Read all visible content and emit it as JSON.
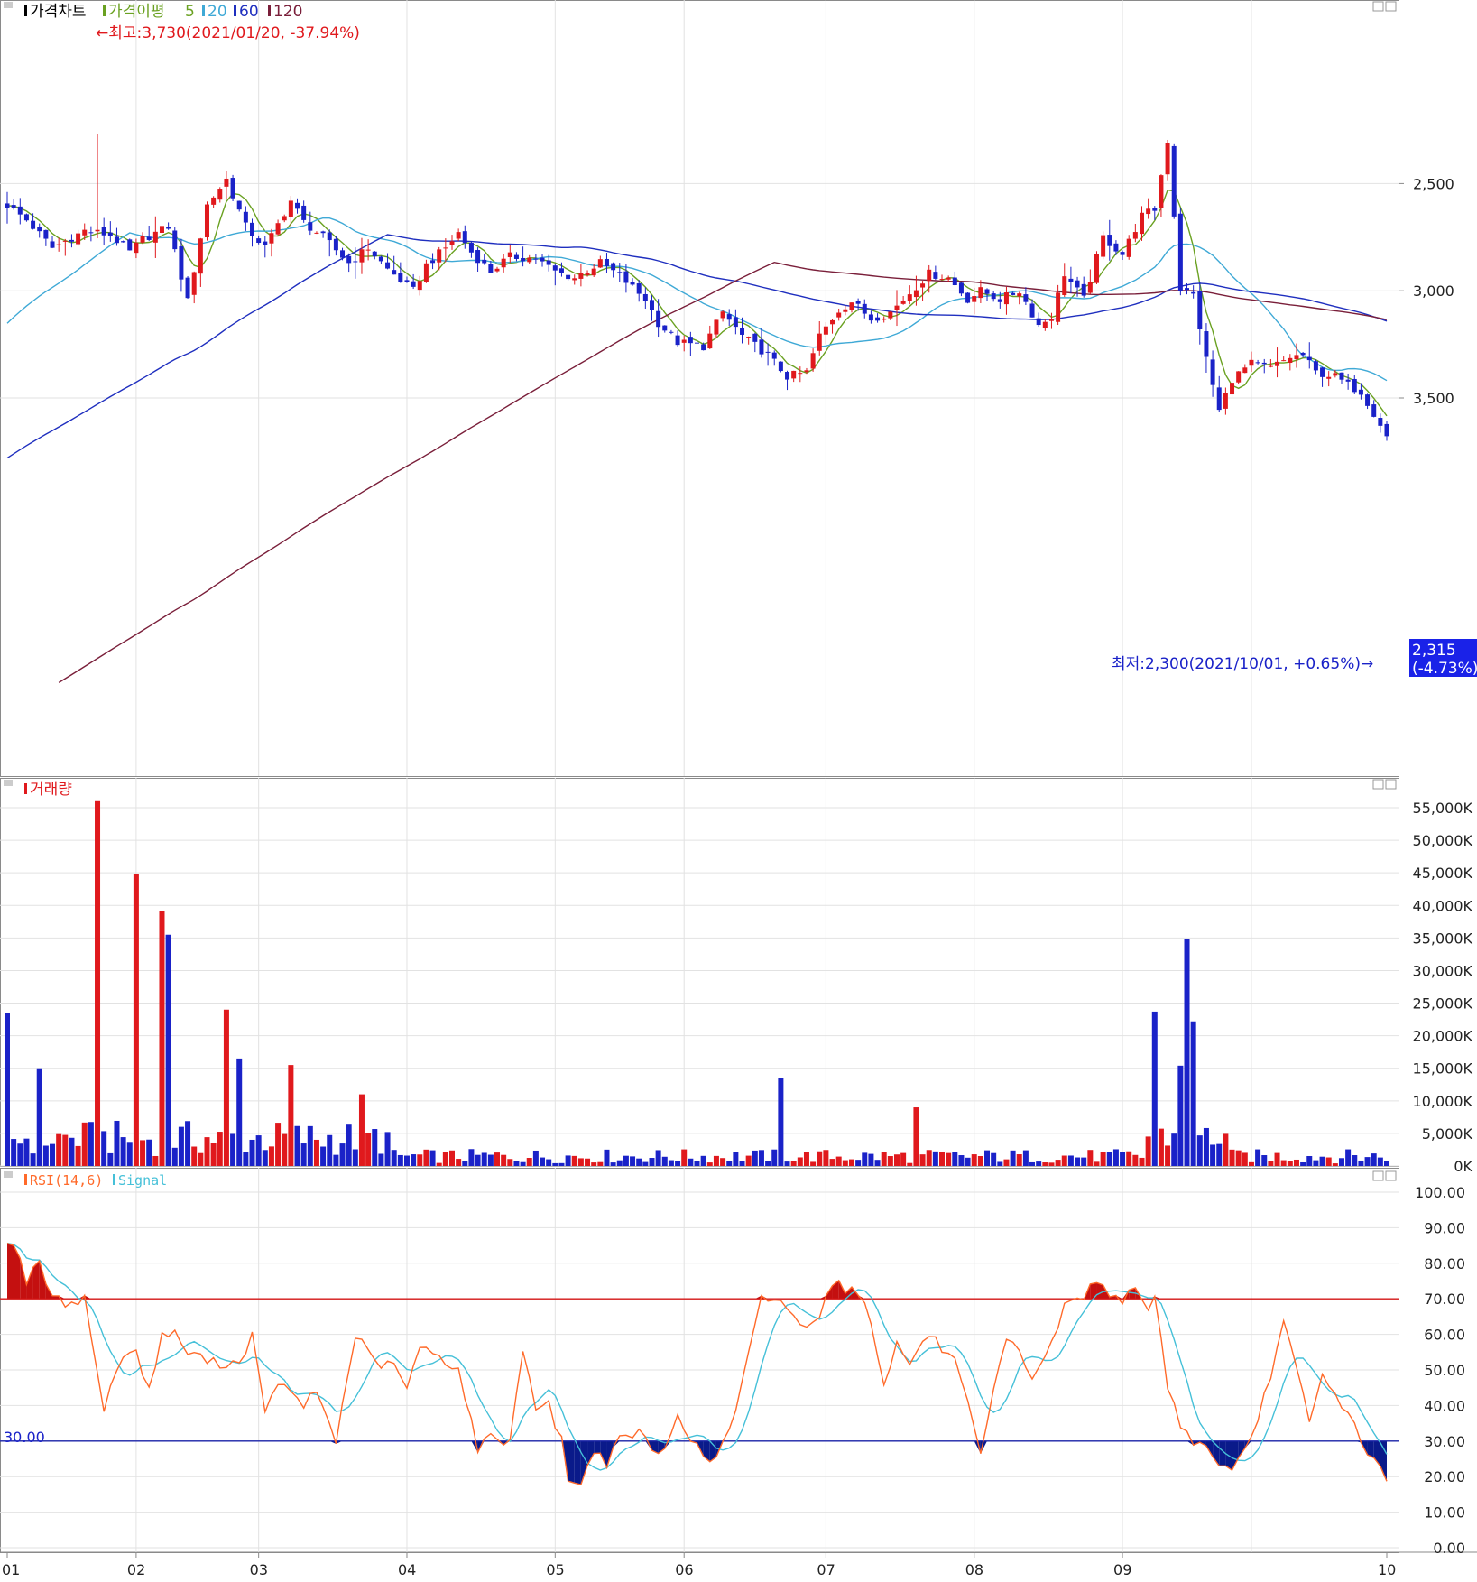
{
  "panels": {
    "price": {
      "legend": {
        "name": "가격차트",
        "ma_prefix": "가격이평",
        "ma": [
          {
            "label": "5",
            "color": "#6aa121"
          },
          {
            "label": "20",
            "color": "#3fa9d6"
          },
          {
            "label": "60",
            "color": "#1f2fbf"
          },
          {
            "label": "120",
            "color": "#7a1f3a"
          }
        ]
      },
      "high_annotation": "←최고:3,730(2021/01/20, -37.94%)",
      "low_annotation": "최저:2,300(2021/10/01, +0.65%)→",
      "current_price": "2,315",
      "current_change": "(-4.73%)",
      "y_ticks": [
        "3,500",
        "3,000",
        "2,500"
      ]
    },
    "volume": {
      "legend": {
        "name": "거래량"
      },
      "y_ticks": [
        "55,000K",
        "50,000K",
        "45,000K",
        "40,000K",
        "35,000K",
        "30,000K",
        "25,000K",
        "20,000K",
        "15,000K",
        "10,000K",
        "5,000K",
        "0K"
      ]
    },
    "rsi": {
      "legend": {
        "rsi": "RSI(14,6)",
        "signal": "Signal"
      },
      "level_label": "30.00",
      "y_ticks": [
        "100.00",
        "90.00",
        "80.00",
        "70.00",
        "60.00",
        "50.00",
        "40.00",
        "30.00",
        "20.00",
        "10.00",
        "0.00"
      ]
    }
  },
  "x_labels": [
    "01",
    "02",
    "03",
    "04",
    "05",
    "06",
    "07",
    "08",
    "09",
    "10"
  ],
  "colors": {
    "up": "#e0191d",
    "down": "#1a22c8",
    "rsi": "#ff6a2a",
    "signal": "#45c0d8",
    "overbought_fill": "#c41010",
    "oversold_fill": "#0a1a8a"
  },
  "chart_data": [
    {
      "type": "candlestick",
      "title": "가격차트",
      "ylim": [
        2050,
        3800
      ],
      "y_ticks": [
        2500,
        3000,
        3500
      ],
      "high": {
        "value": 3730,
        "date": "2021/01/20",
        "pct": -37.94
      },
      "low": {
        "value": 2300,
        "date": "2021/10/01",
        "pct": 0.65
      },
      "last": {
        "value": 2315,
        "pct": -4.73
      },
      "close_anchors": [
        [
          0,
          3400
        ],
        [
          3,
          3330
        ],
        [
          7,
          3200
        ],
        [
          12,
          3280
        ],
        [
          16,
          3260
        ],
        [
          19,
          3180
        ],
        [
          21,
          3240
        ],
        [
          25,
          3300
        ],
        [
          28,
          2950
        ],
        [
          31,
          3400
        ],
        [
          34,
          3520
        ],
        [
          37,
          3300
        ],
        [
          40,
          3200
        ],
        [
          44,
          3420
        ],
        [
          46,
          3320
        ],
        [
          49,
          3250
        ],
        [
          53,
          3130
        ],
        [
          56,
          3200
        ],
        [
          59,
          3100
        ],
        [
          63,
          3000
        ],
        [
          65,
          3120
        ],
        [
          68,
          3200
        ],
        [
          70,
          3270
        ],
        [
          72,
          3180
        ],
        [
          75,
          3090
        ],
        [
          78,
          3160
        ],
        [
          82,
          3150
        ],
        [
          85,
          3090
        ],
        [
          88,
          3060
        ],
        [
          92,
          3130
        ],
        [
          95,
          3070
        ],
        [
          99,
          2960
        ],
        [
          101,
          2850
        ],
        [
          104,
          2760
        ],
        [
          108,
          2740
        ],
        [
          111,
          2900
        ],
        [
          114,
          2790
        ],
        [
          118,
          2700
        ],
        [
          121,
          2600
        ],
        [
          124,
          2620
        ],
        [
          126,
          2790
        ],
        [
          129,
          2910
        ],
        [
          131,
          2950
        ],
        [
          134,
          2870
        ],
        [
          137,
          2900
        ],
        [
          140,
          2990
        ],
        [
          143,
          3080
        ],
        [
          146,
          3060
        ],
        [
          149,
          2960
        ],
        [
          151,
          3000
        ],
        [
          154,
          2960
        ],
        [
          157,
          3000
        ],
        [
          160,
          2840
        ],
        [
          162,
          2880
        ],
        [
          164,
          3080
        ],
        [
          167,
          2960
        ],
        [
          170,
          3250
        ],
        [
          173,
          3170
        ],
        [
          176,
          3350
        ],
        [
          178,
          3380
        ],
        [
          180,
          3700
        ],
        [
          182,
          3010
        ],
        [
          184,
          2980
        ],
        [
          186,
          2680
        ],
        [
          188,
          2440
        ],
        [
          190,
          2590
        ],
        [
          193,
          2660
        ],
        [
          196,
          2640
        ],
        [
          199,
          2690
        ],
        [
          201,
          2700
        ],
        [
          203,
          2620
        ],
        [
          206,
          2600
        ],
        [
          208,
          2560
        ],
        [
          210,
          2530
        ],
        [
          212,
          2430
        ],
        [
          213,
          2380
        ],
        [
          214,
          2320
        ]
      ],
      "ma_periods": [
        5,
        20,
        60,
        120
      ]
    },
    {
      "type": "bar",
      "title": "거래량",
      "unit": "K",
      "ylim": [
        0,
        57000
      ],
      "spikes": [
        [
          0,
          23500
        ],
        [
          5,
          15000
        ],
        [
          14,
          56000
        ],
        [
          20,
          44800
        ],
        [
          24,
          39200
        ],
        [
          25,
          35500
        ],
        [
          34,
          24000
        ],
        [
          36,
          16500
        ],
        [
          44,
          15500
        ],
        [
          55,
          11000
        ],
        [
          120,
          13500
        ],
        [
          141,
          9000
        ],
        [
          178,
          23700
        ],
        [
          182,
          15400
        ],
        [
          183,
          34900
        ],
        [
          184,
          22200
        ]
      ]
    },
    {
      "type": "line",
      "title": "RSI(14,6)",
      "series": [
        {
          "name": "RSI(14,6)"
        },
        {
          "name": "Signal"
        }
      ],
      "ylim": [
        0,
        100
      ],
      "levels": [
        70,
        30
      ],
      "rsi_anchors": [
        [
          0,
          87
        ],
        [
          2,
          82
        ],
        [
          3,
          75
        ],
        [
          5,
          80
        ],
        [
          7,
          70
        ],
        [
          9,
          69
        ],
        [
          12,
          70
        ],
        [
          15,
          39
        ],
        [
          18,
          55
        ],
        [
          20,
          55
        ],
        [
          22,
          44
        ],
        [
          24,
          60
        ],
        [
          26,
          60
        ],
        [
          28,
          55
        ],
        [
          32,
          52
        ],
        [
          36,
          52
        ],
        [
          38,
          60
        ],
        [
          40,
          37
        ],
        [
          42,
          47
        ],
        [
          44,
          43
        ],
        [
          46,
          40
        ],
        [
          48,
          44
        ],
        [
          51,
          30
        ],
        [
          54,
          60
        ],
        [
          57,
          52
        ],
        [
          60,
          51
        ],
        [
          62,
          45
        ],
        [
          64,
          56
        ],
        [
          67,
          54
        ],
        [
          70,
          50
        ],
        [
          73,
          28
        ],
        [
          75,
          31
        ],
        [
          78,
          30
        ],
        [
          80,
          56
        ],
        [
          82,
          40
        ],
        [
          84,
          40
        ],
        [
          86,
          30
        ],
        [
          87,
          20
        ],
        [
          89,
          17
        ],
        [
          91,
          28
        ],
        [
          93,
          24
        ],
        [
          95,
          30
        ],
        [
          98,
          33
        ],
        [
          100,
          27
        ],
        [
          102,
          27
        ],
        [
          104,
          38
        ],
        [
          106,
          31
        ],
        [
          108,
          25
        ],
        [
          110,
          25
        ],
        [
          113,
          38
        ],
        [
          117,
          70
        ],
        [
          120,
          70
        ],
        [
          123,
          62
        ],
        [
          126,
          66
        ],
        [
          128,
          75
        ],
        [
          130,
          73
        ],
        [
          133,
          70
        ],
        [
          136,
          47
        ],
        [
          138,
          57
        ],
        [
          140,
          52
        ],
        [
          143,
          60
        ],
        [
          147,
          52
        ],
        [
          149,
          40
        ],
        [
          151,
          25
        ],
        [
          153,
          44
        ],
        [
          155,
          58
        ],
        [
          157,
          55
        ],
        [
          159,
          48
        ],
        [
          162,
          57
        ],
        [
          164,
          68
        ],
        [
          167,
          71
        ],
        [
          169,
          75
        ],
        [
          171,
          72
        ],
        [
          173,
          70
        ],
        [
          175,
          72
        ],
        [
          177,
          66
        ],
        [
          178,
          72
        ],
        [
          180,
          45
        ],
        [
          182,
          35
        ],
        [
          184,
          30
        ],
        [
          186,
          28
        ],
        [
          188,
          24
        ],
        [
          190,
          21
        ],
        [
          193,
          30
        ],
        [
          196,
          49
        ],
        [
          198,
          63
        ],
        [
          200,
          50
        ],
        [
          202,
          35
        ],
        [
          204,
          48
        ],
        [
          206,
          43
        ],
        [
          208,
          38
        ],
        [
          210,
          30
        ],
        [
          212,
          25
        ],
        [
          214,
          18
        ]
      ],
      "signal_period": 6
    }
  ]
}
